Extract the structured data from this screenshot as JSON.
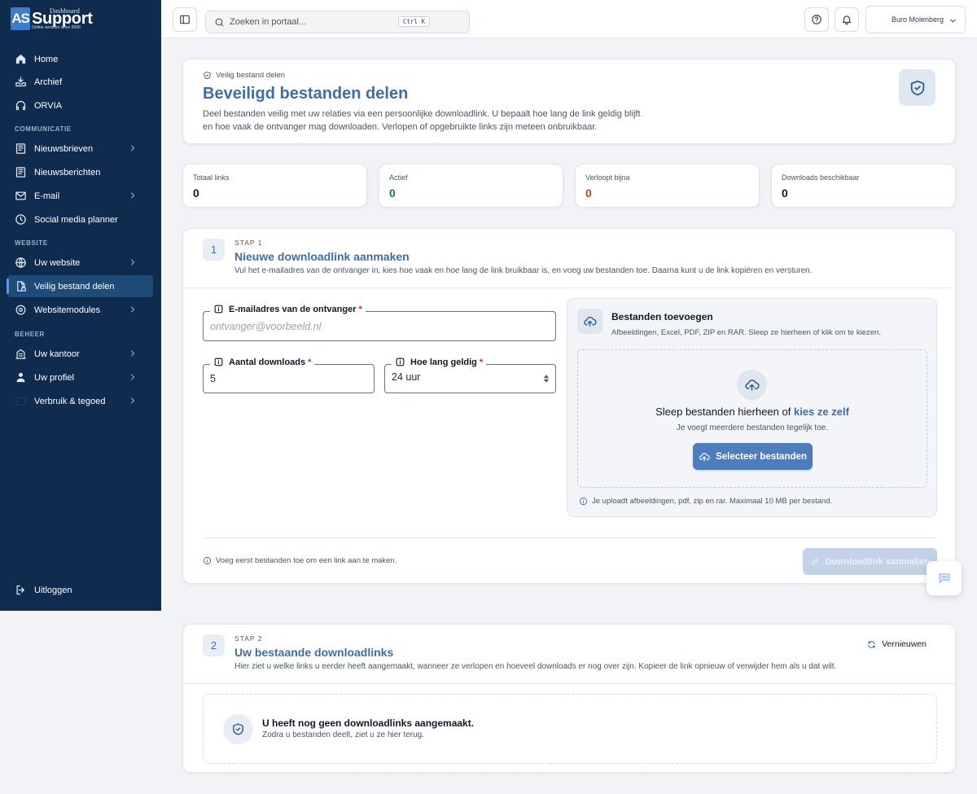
{
  "brand": {
    "logo_as": "AS",
    "logo_top": "Dashboard",
    "logo_main": "Support",
    "logo_tagline": "Online services since 2000"
  },
  "sidebar": {
    "items": [
      {
        "label": "Home"
      },
      {
        "label": "Archief"
      },
      {
        "label": "ORVIA"
      },
      {
        "label": "Nieuwsbrieven"
      },
      {
        "label": "Nieuwsberichten"
      },
      {
        "label": "E-mail"
      },
      {
        "label": "Social media planner"
      },
      {
        "label": "Uw website"
      },
      {
        "label": "Veilig bestand delen"
      },
      {
        "label": "Websitemodules"
      },
      {
        "label": "Uw kantoor"
      },
      {
        "label": "Uw profiel"
      },
      {
        "label": "Verbruik & tegoed"
      }
    ],
    "sections": {
      "communicatie": "COMMUNICATIE",
      "website": "WEBSITE",
      "beheer": "BEHEER"
    },
    "logout": "Uitloggen"
  },
  "topbar": {
    "search_placeholder": "Zoeken in portaal...",
    "search_shortcut": "Ctrl K",
    "account": "Buro Molenberg"
  },
  "hero": {
    "kicker": "Veilig bestand delen",
    "title": "Beveiligd bestanden delen",
    "description": "Deel bestanden veilig met uw relaties via een persoonlijke downloadlink. U bepaalt hoe lang de link geldig blijft en hoe vaak de ontvanger mag downloaden. Verlopen of opgebruikte links zijn meteen onbruikbaar."
  },
  "stats": [
    {
      "label": "Totaal links",
      "value": "0",
      "color": "#111827"
    },
    {
      "label": "Actief",
      "value": "0",
      "color": "#15803d"
    },
    {
      "label": "Verloopt bijna",
      "value": "0",
      "color": "#c2410c"
    },
    {
      "label": "Downloads beschikbaar",
      "value": "0",
      "color": "#111827"
    }
  ],
  "step1": {
    "number": "1",
    "kicker": "STAP 1",
    "title": "Nieuwe downloadlink aanmaken",
    "description": "Vul het e-mailadres van de ontvanger in, kies hoe vaak en hoe lang de link bruikbaar is, en voeg uw bestanden toe. Daarna kunt u de link kopiëren en versturen.",
    "email_label": "E-mailadres van de ontvanger",
    "email_placeholder": "ontvanger@voorbeeld.nl",
    "downloads_label": "Aantal downloads",
    "downloads_value": "5",
    "valid_label": "Hoe lang geldig",
    "valid_value": "24 uur",
    "required_mark": "*",
    "files_title": "Bestanden toevoegen",
    "files_subtitle": "Afbeeldingen, Excel, PDF, ZIP en RAR. Sleep ze hierheen of klik om te kiezen.",
    "drop_text": "Sleep bestanden hierheen of",
    "drop_link": "kies ze zelf",
    "drop_sub": "Je voegt meerdere bestanden tegelijk toe.",
    "select_button": "Selecteer bestanden",
    "upload_hint": "Je uploadt afbeeldingen, pdf, zip en rar. Maximaal 10 MB per bestand.",
    "footer_hint": "Voeg eerst bestanden toe om een link aan te maken.",
    "create_button": "Downloadlink aanmaken"
  },
  "step2": {
    "number": "2",
    "kicker": "STAP 2",
    "title": "Uw bestaande downloadlinks",
    "description": "Hier ziet u welke links u eerder heeft aangemaakt, wanneer ze verlopen en hoeveel downloads er nog over zijn. Kopieer de link opnieuw of verwijder hem als u dat wilt.",
    "refresh": "Vernieuwen",
    "empty_title": "U heeft nog geen downloadlinks aangemaakt.",
    "empty_sub": "Zodra u bestanden deelt, ziet u ze hier terug."
  }
}
